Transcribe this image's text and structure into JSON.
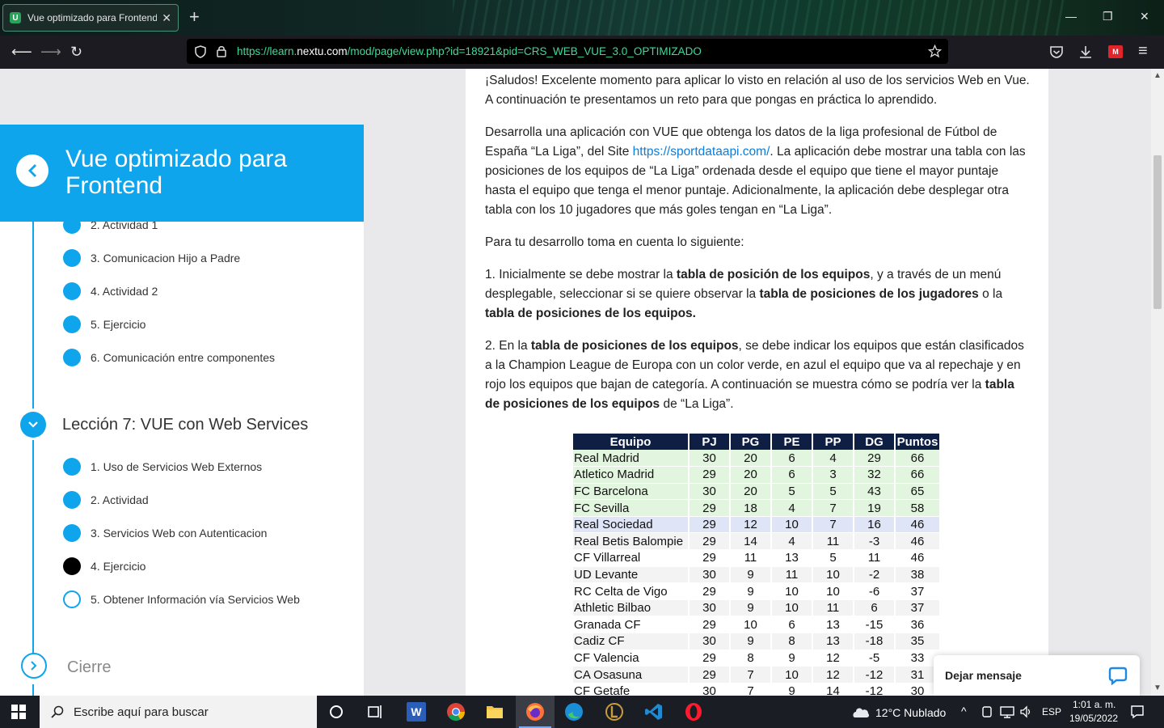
{
  "browser": {
    "tab_title": "Vue optimizado para Frontend",
    "tab_favicon": "U",
    "url_prefix": "https://learn.",
    "url_domain": "nextu.com",
    "url_rest": "/mod/page/view.php?id=18921&pid=CRS_WEB_VUE_3.0_OPTIMIZADO"
  },
  "sidebar": {
    "course_title": "Vue optimizado para Frontend",
    "prev_items": [
      {
        "label": "2. Actividad 1"
      },
      {
        "label": "3. Comunicacion Hijo a Padre"
      },
      {
        "label": "4. Actividad 2"
      },
      {
        "label": "5. Ejercicio"
      },
      {
        "label": "6. Comunicación entre componentes"
      }
    ],
    "lesson_title": "Lección 7: VUE con Web Services",
    "lesson_items": [
      {
        "label": "1. Uso de Servicios Web Externos",
        "state": "done"
      },
      {
        "label": "2. Actividad",
        "state": "done"
      },
      {
        "label": "3. Servicios Web con Autenticacion",
        "state": "done"
      },
      {
        "label": "4. Ejercicio",
        "state": "current"
      },
      {
        "label": "5. Obtener Información vía Servicios Web",
        "state": "pending"
      }
    ],
    "closing_title": "Cierre"
  },
  "content": {
    "p1": "¡Saludos! Excelente momento para aplicar lo visto en relación al uso de los servicios Web en Vue. A continuación te presentamos un reto para que pongas en práctica lo aprendido.",
    "p2_a": "Desarrolla una aplicación con VUE que obtenga los datos de la liga profesional de Fútbol de España “La Liga”, del Site ",
    "p2_link": "https://sportdataapi.com/",
    "p2_b": ". La aplicación debe mostrar una tabla con las posiciones de los equipos de “La Liga” ordenada desde el equipo que tiene el mayor puntaje hasta el equipo que tenga el menor puntaje. Adicionalmente, la aplicación debe desplegar otra tabla con los 10 jugadores que más goles tengan en “La Liga”.",
    "p3": "Para tu desarrollo toma en cuenta lo siguiente:",
    "p4_a": "1. Inicialmente se debe mostrar la ",
    "p4_b1": "tabla de posición de los equipos",
    "p4_c": ", y a través de un menú desplegable, seleccionar si se quiere observar la ",
    "p4_b2": "tabla de posiciones de los jugadores",
    "p4_d": " o la ",
    "p4_b3": "tabla de posiciones de los equipos.",
    "p5_a": "2. En la ",
    "p5_b1": "tabla de posiciones de los equipos",
    "p5_c": ", se debe indicar los equipos que están clasificados a la Champion League de Europa con un color verde, en azul el equipo que va al repechaje y en rojo los equipos que bajan de categoría. A continuación se muestra cómo se podría ver la ",
    "p5_b2": "tabla de posiciones de los equipos",
    "p5_d": " de “La Liga”."
  },
  "standings": {
    "headers": [
      "Equipo",
      "PJ",
      "PG",
      "PE",
      "PP",
      "DG",
      "Puntos"
    ],
    "rows": [
      {
        "zone": "green",
        "cells": [
          "Real Madrid",
          "30",
          "20",
          "6",
          "4",
          "29",
          "66"
        ]
      },
      {
        "zone": "green",
        "cells": [
          "Atletico Madrid",
          "29",
          "20",
          "6",
          "3",
          "32",
          "66"
        ]
      },
      {
        "zone": "green",
        "cells": [
          "FC Barcelona",
          "30",
          "20",
          "5",
          "5",
          "43",
          "65"
        ]
      },
      {
        "zone": "green",
        "cells": [
          "FC Sevilla",
          "29",
          "18",
          "4",
          "7",
          "19",
          "58"
        ]
      },
      {
        "zone": "blue",
        "cells": [
          "Real Sociedad",
          "29",
          "12",
          "10",
          "7",
          "16",
          "46"
        ]
      },
      {
        "zone": "plain",
        "cells": [
          "Real Betis Balompie",
          "29",
          "14",
          "4",
          "11",
          "-3",
          "46"
        ]
      },
      {
        "zone": "plain",
        "cells": [
          "CF Villarreal",
          "29",
          "11",
          "13",
          "5",
          "11",
          "46"
        ]
      },
      {
        "zone": "plain",
        "cells": [
          "UD Levante",
          "30",
          "9",
          "11",
          "10",
          "-2",
          "38"
        ]
      },
      {
        "zone": "plain",
        "cells": [
          "RC Celta de Vigo",
          "29",
          "9",
          "10",
          "10",
          "-6",
          "37"
        ]
      },
      {
        "zone": "plain",
        "cells": [
          "Athletic Bilbao",
          "30",
          "9",
          "10",
          "11",
          "6",
          "37"
        ]
      },
      {
        "zone": "plain",
        "cells": [
          "Granada CF",
          "29",
          "10",
          "6",
          "13",
          "-15",
          "36"
        ]
      },
      {
        "zone": "plain",
        "cells": [
          "Cadiz CF",
          "30",
          "9",
          "8",
          "13",
          "-18",
          "35"
        ]
      },
      {
        "zone": "plain",
        "cells": [
          "CF Valencia",
          "29",
          "8",
          "9",
          "12",
          "-5",
          "33"
        ]
      },
      {
        "zone": "plain",
        "cells": [
          "CA Osasuna",
          "29",
          "7",
          "10",
          "12",
          "-12",
          "31"
        ]
      },
      {
        "zone": "plain",
        "cells": [
          "CF Getafe",
          "30",
          "7",
          "9",
          "14",
          "-12",
          "30"
        ]
      }
    ]
  },
  "chat": {
    "label": "Dejar mensaje"
  },
  "taskbar": {
    "search_placeholder": "Escribe aquí para buscar",
    "weather": "12°C  Nublado",
    "language": "ESP",
    "time": "1:01 a. m.",
    "date": "19/05/2022"
  },
  "colors": {
    "accent": "#0ea5ec",
    "table_header": "#0f1f44",
    "champions": "#e2f6df",
    "playoff": "#dfe4f6"
  }
}
